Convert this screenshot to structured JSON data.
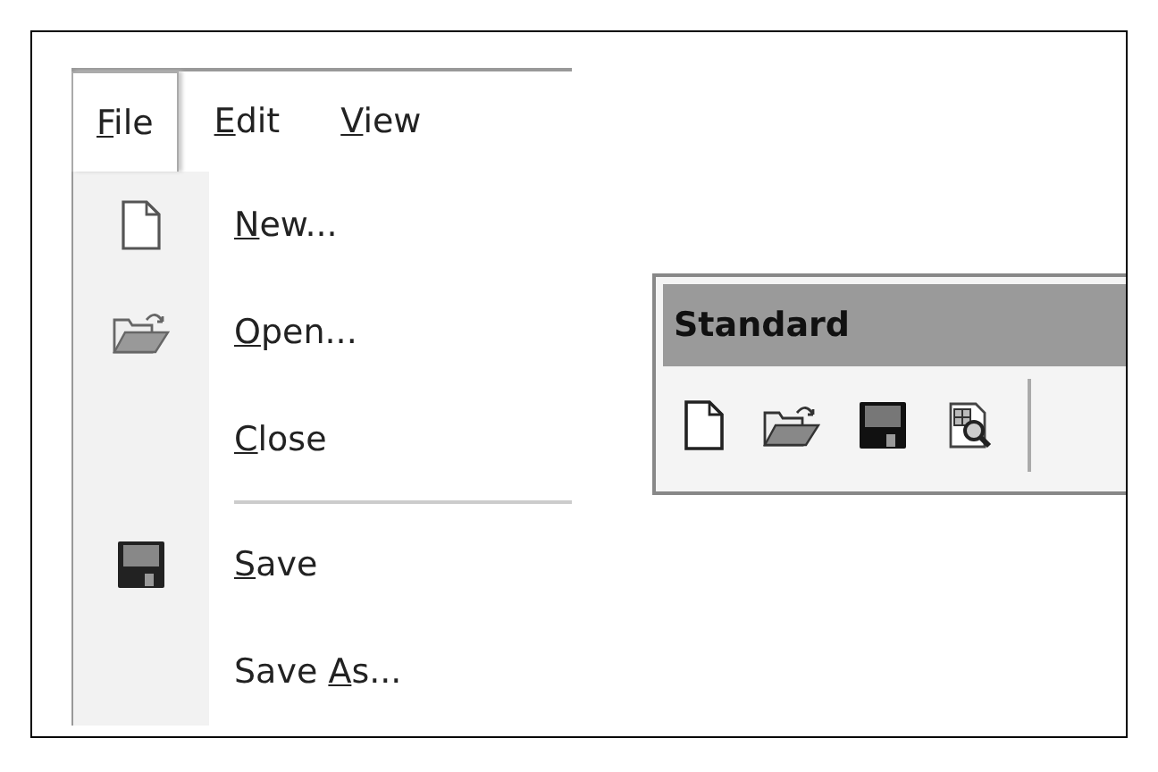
{
  "menubar": [
    {
      "key": "F",
      "post": "ile",
      "selected": true
    },
    {
      "key": "E",
      "post": "dit",
      "selected": false
    },
    {
      "key": "V",
      "post": "iew",
      "selected": false
    }
  ],
  "menu": {
    "items": [
      {
        "kind": "item",
        "key": "N",
        "post": "ew..."
      },
      {
        "kind": "item",
        "key": "O",
        "post": "pen..."
      },
      {
        "kind": "item",
        "key": "C",
        "post": "lose"
      },
      {
        "kind": "separator"
      },
      {
        "kind": "item",
        "key": "S",
        "post": "ave"
      },
      {
        "kind": "item",
        "pre": "Save ",
        "key": "A",
        "post": "s..."
      }
    ]
  },
  "toolbar": {
    "title": "Standard"
  }
}
